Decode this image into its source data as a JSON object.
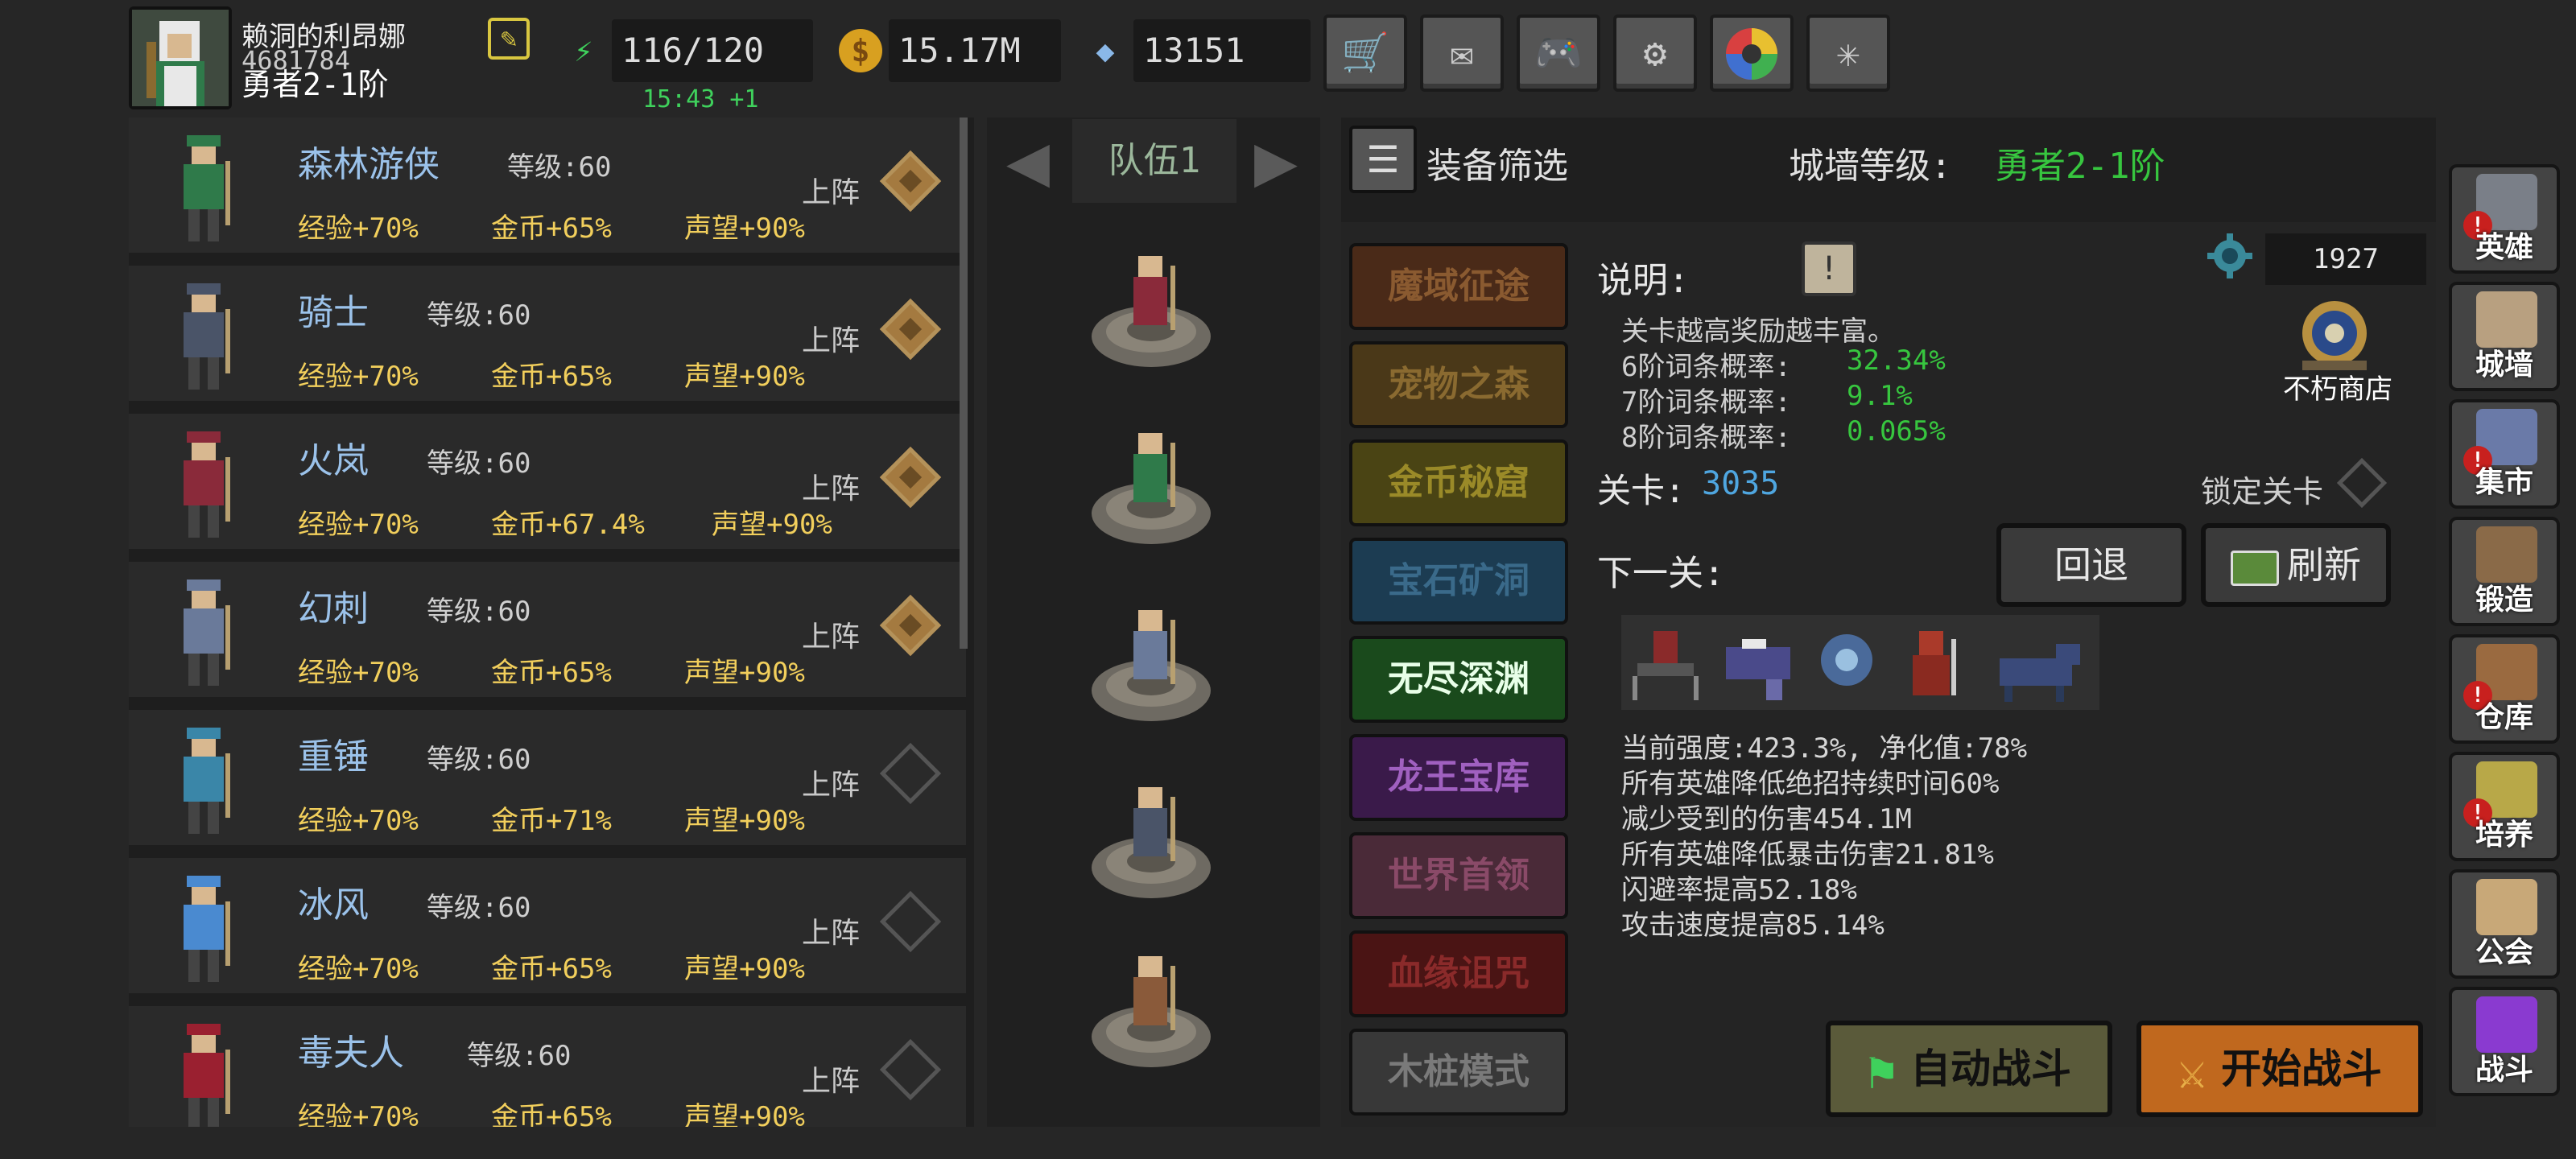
{
  "player": {
    "name": "赖洞的利昂娜",
    "id": "4681784",
    "rank": "勇者2-1阶"
  },
  "resources": {
    "stamina": "116/120",
    "stamina_timer": "15:43 +1",
    "gold": "15.17M",
    "gems": "13151"
  },
  "top_menu": [
    "shop-cart-icon",
    "mail-icon",
    "gamepad-icon",
    "gear-icon",
    "color-wheel-icon",
    "fireworks-icon"
  ],
  "heroes": [
    {
      "name": "森林游侠",
      "level": "等级:60",
      "exp": "经验+70%",
      "gold": "金币+65%",
      "fame": "声望+90%",
      "deploy": "上阵",
      "deployed": true,
      "color": "#2f7a4a"
    },
    {
      "name": "骑士",
      "level": "等级:60",
      "exp": "经验+70%",
      "gold": "金币+65%",
      "fame": "声望+90%",
      "deploy": "上阵",
      "deployed": true,
      "color": "#4a5468"
    },
    {
      "name": "火岚",
      "level": "等级:60",
      "exp": "经验+70%",
      "gold": "金币+67.4%",
      "fame": "声望+90%",
      "deploy": "上阵",
      "deployed": true,
      "color": "#8a2a3a"
    },
    {
      "name": "幻刺",
      "level": "等级:60",
      "exp": "经验+70%",
      "gold": "金币+65%",
      "fame": "声望+90%",
      "deploy": "上阵",
      "deployed": true,
      "color": "#6a7a9a"
    },
    {
      "name": "重锤",
      "level": "等级:60",
      "exp": "经验+70%",
      "gold": "金币+71%",
      "fame": "声望+90%",
      "deploy": "上阵",
      "deployed": false,
      "color": "#3a86a8"
    },
    {
      "name": "冰风",
      "level": "等级:60",
      "exp": "经验+70%",
      "gold": "金币+65%",
      "fame": "声望+90%",
      "deploy": "上阵",
      "deployed": false,
      "color": "#4a8ad0"
    },
    {
      "name": "毒夫人",
      "level": "等级:60",
      "exp": "经验+70%",
      "gold": "金币+65%",
      "fame": "声望+90%",
      "deploy": "上阵",
      "deployed": false,
      "color": "#9a2030"
    }
  ],
  "team": {
    "label": "队伍1"
  },
  "filter": {
    "label": "装备筛选"
  },
  "wall": {
    "label": "城墙等级:",
    "value": "勇者2-1阶"
  },
  "modes": [
    {
      "label": "魔域征途",
      "bg": "#4a2a18",
      "fg": "#8a5a30"
    },
    {
      "label": "宠物之森",
      "bg": "#4a3818",
      "fg": "#8a6a30"
    },
    {
      "label": "金币秘窟",
      "bg": "#4a4414",
      "fg": "#9a8a28"
    },
    {
      "label": "宝石矿洞",
      "bg": "#1c3c52",
      "fg": "#3a6a8a"
    },
    {
      "label": "无尽深渊",
      "bg": "#1a4a1c",
      "fg": "#e8ffe8"
    },
    {
      "label": "龙王宝库",
      "bg": "#3a1a4a",
      "fg": "#a060c0"
    },
    {
      "label": "世界首领",
      "bg": "#4a2a38",
      "fg": "#8a4a68"
    },
    {
      "label": "血缘诅咒",
      "bg": "#4a1414",
      "fg": "#8a2a2a"
    },
    {
      "label": "木桩模式",
      "bg": "#383838",
      "fg": "#7a7a7a"
    }
  ],
  "description": {
    "label": "说明:",
    "intro": "关卡越高奖励越丰富。",
    "probs": [
      {
        "label": "6阶词条概率:",
        "value": "32.34%"
      },
      {
        "label": "7阶词条概率:",
        "value": "9.1%"
      },
      {
        "label": "8阶词条概率:",
        "value": "0.065%"
      }
    ]
  },
  "currency": {
    "value": "1927",
    "shop": "不朽商店"
  },
  "stage": {
    "label": "关卡:",
    "value": "3035",
    "lock": "锁定关卡"
  },
  "next": {
    "label": "下一关:",
    "back": "回退",
    "refresh": "刷新"
  },
  "stats": [
    "当前强度:423.3%, 净化值:78%",
    "所有英雄降低绝招持续时间60%",
    "减少受到的伤害454.1M",
    "所有英雄降低暴击伤害21.81%",
    "闪避率提高52.18%",
    "攻击速度提高85.14%"
  ],
  "battle": {
    "auto": "自动战斗",
    "start": "开始战斗"
  },
  "side_menu": [
    {
      "label": "英雄",
      "badge": "!",
      "icon": "helmet-icon",
      "color": "#7a7f88"
    },
    {
      "label": "城墙",
      "badge": "",
      "icon": "castle-icon",
      "color": "#b8a080"
    },
    {
      "label": "集市",
      "badge": "!",
      "icon": "market-icon",
      "color": "#6a7aa8"
    },
    {
      "label": "锻造",
      "badge": "",
      "icon": "anvil-icon",
      "color": "#8a6a48"
    },
    {
      "label": "仓库",
      "badge": "!",
      "icon": "chest-icon",
      "color": "#9a6a40"
    },
    {
      "label": "培养",
      "badge": "!",
      "icon": "trophy-icon",
      "color": "#b8a848"
    },
    {
      "label": "公会",
      "badge": "",
      "icon": "lion-icon",
      "color": "#c8a878"
    },
    {
      "label": "战斗",
      "badge": "",
      "icon": "portal-icon",
      "color": "#8a3ad0"
    }
  ],
  "colors": {
    "accent_green": "#37c63f",
    "gold": "#f2cf5c",
    "name_blue": "#9bc2ea",
    "stage_blue": "#4fa6e0"
  }
}
